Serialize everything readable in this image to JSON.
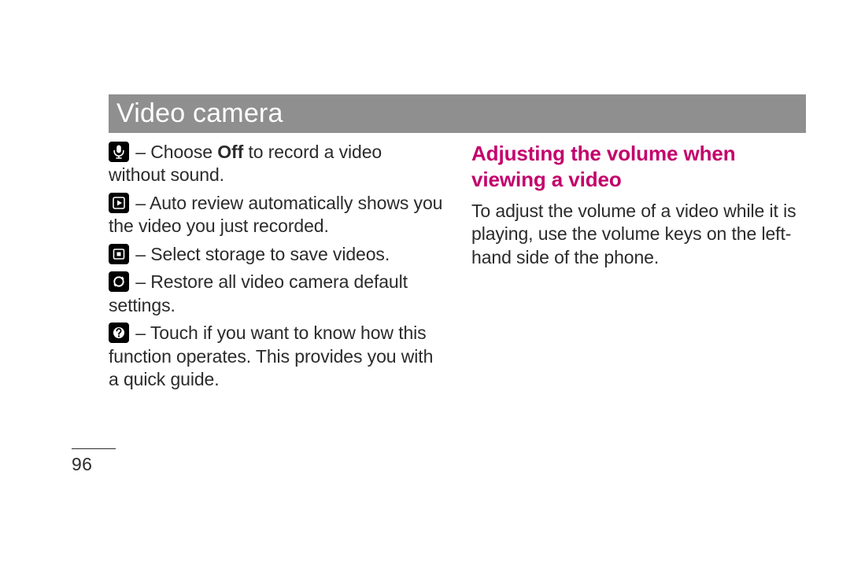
{
  "header": {
    "title": "Video camera"
  },
  "leftColumn": {
    "items": [
      {
        "icon": "microphone-icon",
        "before": " – Choose ",
        "bold": "Off",
        "after": " to record a video without sound."
      },
      {
        "icon": "play-icon",
        "before": " – Auto review automatically shows you the video you just recorded.",
        "bold": "",
        "after": ""
      },
      {
        "icon": "storage-icon",
        "before": " – Select storage to save videos.",
        "bold": "",
        "after": ""
      },
      {
        "icon": "reset-icon",
        "before": " – Restore all video camera default settings.",
        "bold": "",
        "after": ""
      },
      {
        "icon": "help-icon",
        "before": " – Touch if you want to know how this function operates. This provides you with a quick guide.",
        "bold": "",
        "after": ""
      }
    ]
  },
  "rightColumn": {
    "heading": "Adjusting the volume when viewing a video",
    "body": "To adjust the volume of a video while it is playing, use the volume keys on the left-hand side of the phone."
  },
  "pageNumber": "96"
}
